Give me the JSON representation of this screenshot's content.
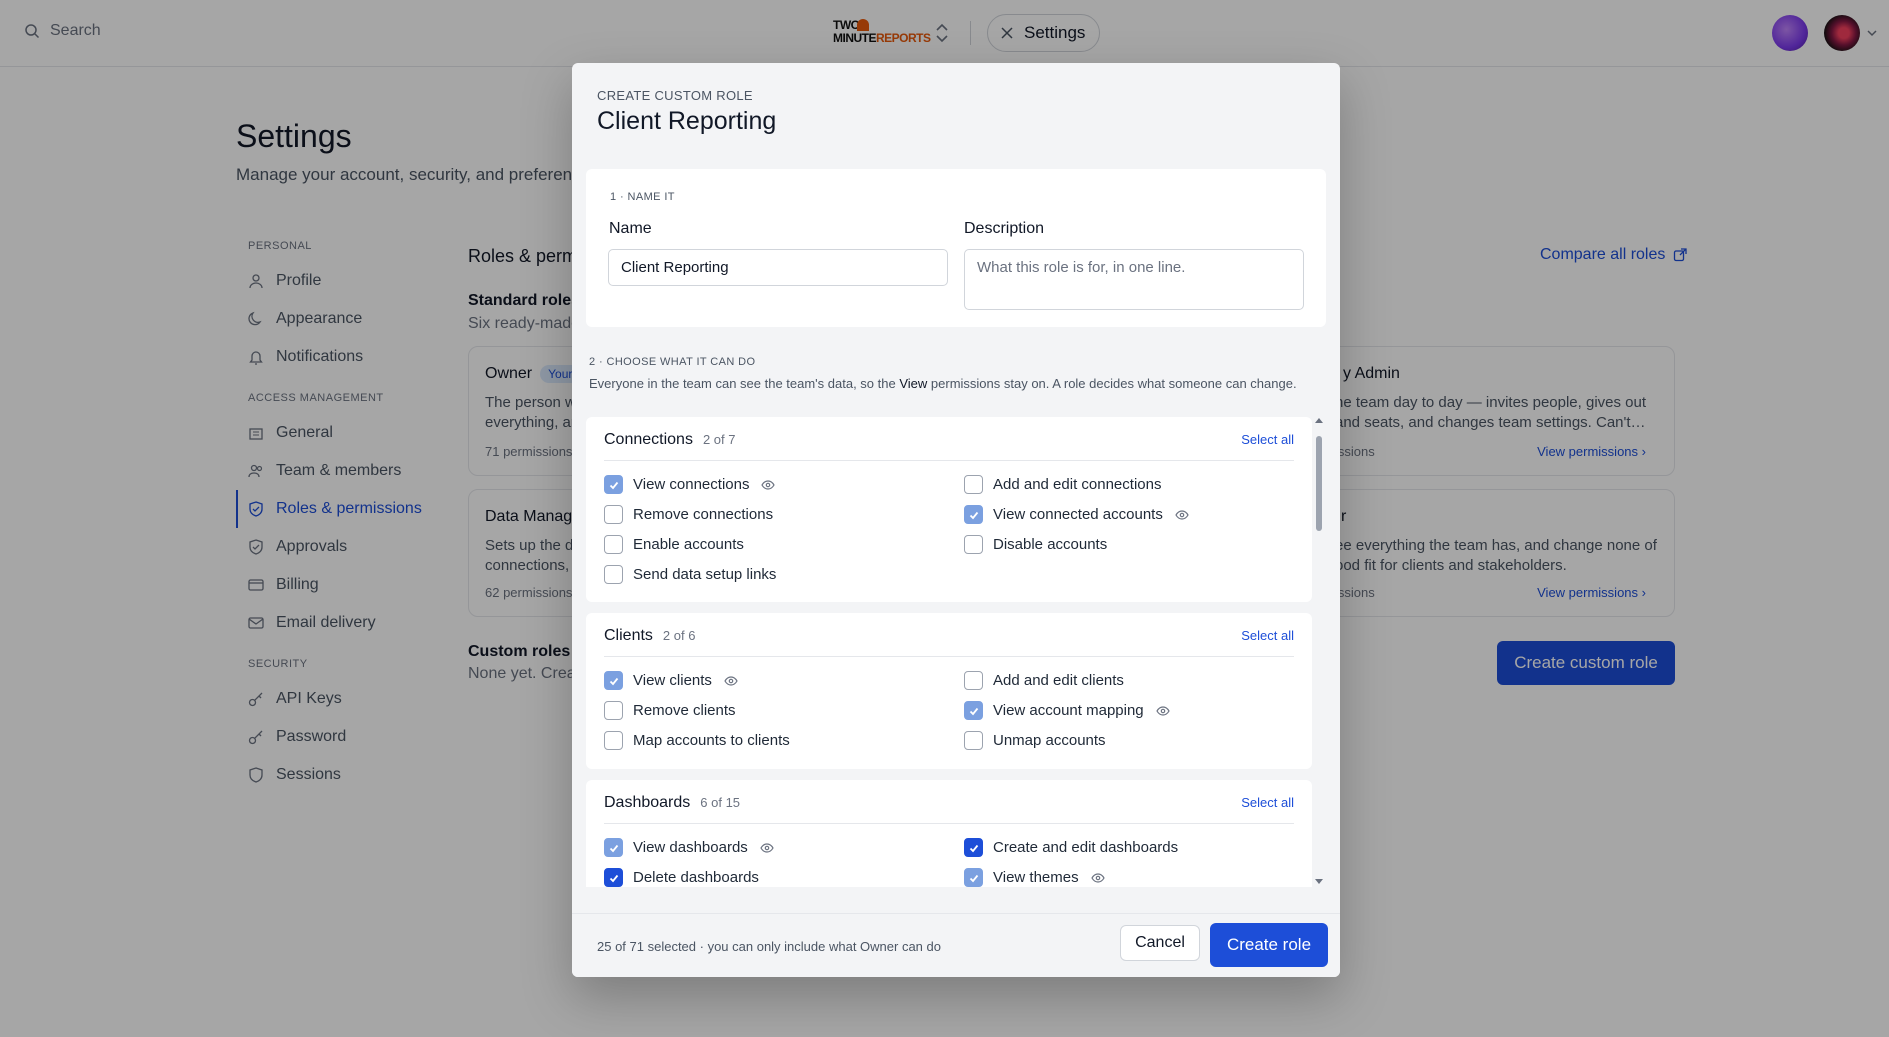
{
  "topbar": {
    "search_placeholder": "Search",
    "logo_line1": "TWO",
    "logo_line2_a": "MINUTE",
    "logo_line2_b": "REPORTS",
    "settings_chip": "Settings"
  },
  "page": {
    "title": "Settings",
    "subtitle": "Manage your account, security, and preferen"
  },
  "sidebar": {
    "personal_label": "PERSONAL",
    "personal": [
      {
        "label": "Profile",
        "icon": "user-icon"
      },
      {
        "label": "Appearance",
        "icon": "moon-icon"
      },
      {
        "label": "Notifications",
        "icon": "bell-icon"
      }
    ],
    "access_label": "ACCESS MANAGEMENT",
    "access": [
      {
        "label": "General",
        "icon": "building-icon"
      },
      {
        "label": "Team & members",
        "icon": "users-icon"
      },
      {
        "label": "Roles & permissions",
        "icon": "shield-icon",
        "active": true
      },
      {
        "label": "Approvals",
        "icon": "shield-check-icon"
      },
      {
        "label": "Billing",
        "icon": "card-icon"
      },
      {
        "label": "Email delivery",
        "icon": "mail-icon"
      }
    ],
    "security_label": "SECURITY",
    "security": [
      {
        "label": "API Keys",
        "icon": "key-icon"
      },
      {
        "label": "Password",
        "icon": "key-icon"
      },
      {
        "label": "Sessions",
        "icon": "shield-icon"
      }
    ]
  },
  "roles": {
    "title": "Roles & permi",
    "compare_link": "Compare all roles",
    "standard_title": "Standard roles",
    "standard_sub": "Six ready-made",
    "cards": [
      {
        "title": "Owner",
        "badge": "Your",
        "desc1": "The person w",
        "desc2": "everything, an",
        "perms": "71 permissions",
        "link": ""
      },
      {
        "title": "y Admin",
        "badge": "",
        "desc1": "he team day to day — invites people, gives out",
        "desc2": "and seats, and changes team settings. Can't…",
        "perms": "issions",
        "link": "View permissions"
      },
      {
        "title": "Data Manage",
        "badge": "",
        "desc1": "Sets up the d",
        "desc2": "connections,",
        "perms": "62 permissions",
        "link": ""
      },
      {
        "title": "r",
        "badge": "",
        "desc1": "ee everything the team has, and change none of",
        "desc2": "ood fit for clients and stakeholders.",
        "perms": "issions",
        "link": "View permissions"
      }
    ],
    "custom_title": "Custom roles",
    "custom_sub": "None yet. Creat",
    "create_custom_button": "Create custom role"
  },
  "modal": {
    "eyebrow": "CREATE CUSTOM ROLE",
    "title": "Client Reporting",
    "step1_label": "1 · NAME IT",
    "name_label": "Name",
    "name_value": "Client Reporting",
    "description_label": "Description",
    "description_placeholder": "What this role is for, in one line.",
    "step2_label": "2 · CHOOSE WHAT IT CAN DO",
    "step2_sub_a": "Everyone in the team can see the team's data, so the ",
    "step2_sub_b": "View",
    "step2_sub_c": " permissions stay on. A role decides what someone can change.",
    "select_all": "Select all",
    "groups": [
      {
        "name": "Connections",
        "count": "2 of 7",
        "items": [
          {
            "label": "View connections",
            "state": "view",
            "eye": true
          },
          {
            "label": "Add and edit connections",
            "state": "off"
          },
          {
            "label": "Remove connections",
            "state": "off"
          },
          {
            "label": "View connected accounts",
            "state": "view",
            "eye": true
          },
          {
            "label": "Enable accounts",
            "state": "off"
          },
          {
            "label": "Disable accounts",
            "state": "off"
          },
          {
            "label": "Send data setup links",
            "state": "off"
          }
        ]
      },
      {
        "name": "Clients",
        "count": "2 of 6",
        "items": [
          {
            "label": "View clients",
            "state": "view",
            "eye": true
          },
          {
            "label": "Add and edit clients",
            "state": "off"
          },
          {
            "label": "Remove clients",
            "state": "off"
          },
          {
            "label": "View account mapping",
            "state": "view",
            "eye": true
          },
          {
            "label": "Map accounts to clients",
            "state": "off"
          },
          {
            "label": "Unmap accounts",
            "state": "off"
          }
        ]
      },
      {
        "name": "Dashboards",
        "count": "6 of 15",
        "items": [
          {
            "label": "View dashboards",
            "state": "view",
            "eye": true
          },
          {
            "label": "Create and edit dashboards",
            "state": "on"
          },
          {
            "label": "Delete dashboards",
            "state": "on"
          },
          {
            "label": "View themes",
            "state": "view",
            "eye": true
          }
        ]
      }
    ],
    "footer_status": "25 of 71 selected · you can only include what Owner can do",
    "cancel_button": "Cancel",
    "create_button": "Create role"
  }
}
